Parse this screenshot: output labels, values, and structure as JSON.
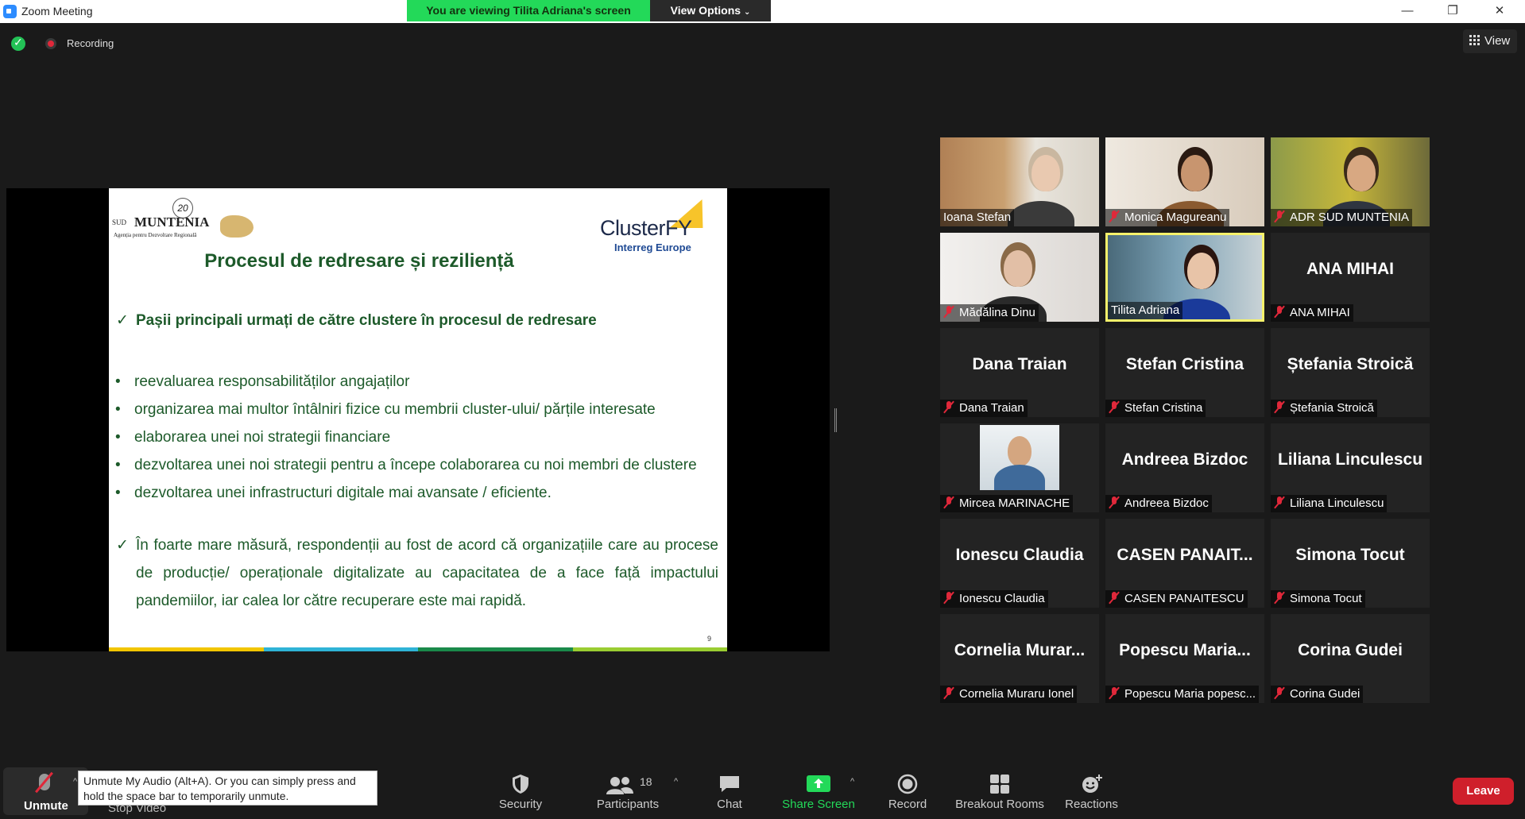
{
  "window": {
    "title": "Zoom Meeting",
    "viewing_banner": "You are viewing Tilita Adriana's screen",
    "view_options": "View Options",
    "minimize": "—",
    "restore": "❐",
    "close": "✕"
  },
  "top": {
    "recording": "Recording",
    "view": "View"
  },
  "slide": {
    "badge": "20",
    "logo_sud": "SUD",
    "logo_muntenia": "MUNTENIA",
    "logo_agency": "Agenția pentru Dezvoltare Regională",
    "logo_clusterfy": "ClusterFY",
    "logo_interreg": "Interreg Europe",
    "title": "Procesul de redresare și reziliență",
    "heading_tick": "✓",
    "heading": "Pașii principali  urmați  de către clustere în procesul de redresare",
    "bullets": [
      "reevaluarea responsabilităților angajaților",
      "organizarea mai multor întâlniri fizice cu membrii cluster-ului/ părțile interesate",
      "elaborarea unei noi strategii financiare",
      "dezvoltarea unei noi strategii pentru a începe colaborarea cu noi membri de clustere",
      "dezvoltarea unei infrastructuri digitale mai avansate / eficiente."
    ],
    "conclusion": "În foarte mare măsură, respondenții au fost de acord că organizațiile care au procese de producție/ operaționale digitalizate au capacitatea de a face față impactului pandemiilor, iar calea lor către recuperare este mai rapidă.",
    "page_number": "9",
    "bar_colors": [
      "#f2c500",
      "#2fb3d6",
      "#1a8a4a",
      "#9acd32"
    ]
  },
  "participants": [
    {
      "label": "Ioana Stefan",
      "name": "",
      "muted": false,
      "video": true
    },
    {
      "label": "Monica Magureanu",
      "name": "",
      "muted": true,
      "video": true
    },
    {
      "label": "ADR SUD MUNTENIA",
      "name": "",
      "muted": true,
      "video": true
    },
    {
      "label": "Mădălina Dinu",
      "name": "",
      "muted": true,
      "video": true
    },
    {
      "label": "Tilita Adriana",
      "name": "",
      "muted": false,
      "video": true,
      "active": true
    },
    {
      "label": "ANA MIHAI",
      "name": "ANA MIHAI",
      "muted": true,
      "video": false
    },
    {
      "label": "Dana Traian",
      "name": "Dana Traian",
      "muted": true,
      "video": false
    },
    {
      "label": "Stefan Cristina",
      "name": "Stefan Cristina",
      "muted": true,
      "video": false
    },
    {
      "label": "Ștefania Stroică",
      "name": "Ștefania Stroică",
      "muted": true,
      "video": false
    },
    {
      "label": "Mircea MARINACHE",
      "name": "",
      "muted": true,
      "video": true
    },
    {
      "label": "Andreea Bizdoc",
      "name": "Andreea Bizdoc",
      "muted": true,
      "video": false
    },
    {
      "label": "Liliana Linculescu",
      "name": "Liliana Linculescu",
      "muted": true,
      "video": false
    },
    {
      "label": "Ionescu Claudia",
      "name": "Ionescu Claudia",
      "muted": true,
      "video": false
    },
    {
      "label": "CASEN PANAITESCU",
      "name": "CASEN  PANAIT...",
      "muted": true,
      "video": false
    },
    {
      "label": "Simona Tocut",
      "name": "Simona Tocut",
      "muted": true,
      "video": false
    },
    {
      "label": "Cornelia Muraru Ionel",
      "name": "Cornelia  Murar...",
      "muted": true,
      "video": false
    },
    {
      "label": "Popescu Maria popesc...",
      "name": "Popescu  Maria...",
      "muted": true,
      "video": false
    },
    {
      "label": "Corina Gudei",
      "name": "Corina Gudei",
      "muted": true,
      "video": false
    }
  ],
  "toolbar": {
    "unmute": "Unmute",
    "tooltip": "Unmute My Audio (Alt+A). Or you can simply press and hold the space bar to temporarily unmute.",
    "stop_video": "Stop Video",
    "security": "Security",
    "participants": "Participants",
    "participants_count": "18",
    "chat": "Chat",
    "share_screen": "Share Screen",
    "record": "Record",
    "breakout_rooms": "Breakout Rooms",
    "reactions": "Reactions",
    "leave": "Leave",
    "caret": "^"
  }
}
